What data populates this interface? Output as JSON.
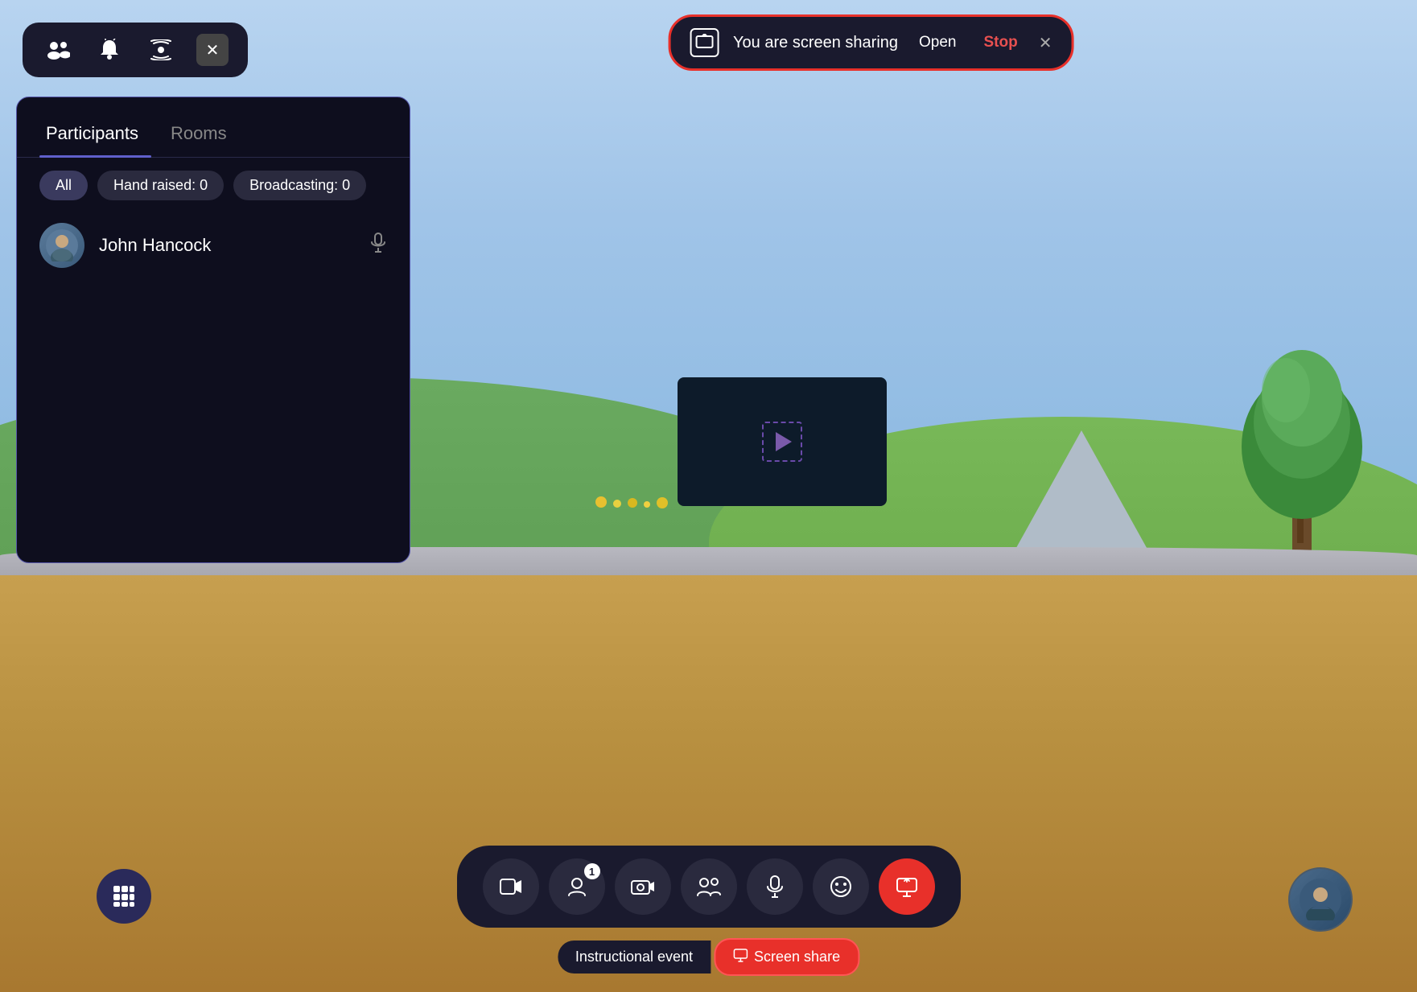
{
  "scene": {
    "background_color": "#87b5d4"
  },
  "top_toolbar": {
    "icons": [
      "people",
      "bell",
      "broadcast",
      "close"
    ],
    "close_label": "✕"
  },
  "screen_share_bar": {
    "title": "You are screen sharing",
    "open_label": "Open",
    "stop_label": "Stop",
    "close_label": "✕"
  },
  "participants_panel": {
    "tabs": [
      {
        "label": "Participants",
        "active": true
      },
      {
        "label": "Rooms",
        "active": false
      }
    ],
    "filters": [
      {
        "label": "All",
        "active": true
      },
      {
        "label": "Hand raised: 0",
        "active": false
      },
      {
        "label": "Broadcasting: 0",
        "active": false
      }
    ],
    "participants": [
      {
        "name": "John Hancock",
        "has_mic": true
      }
    ]
  },
  "bottom_toolbar": {
    "buttons": [
      {
        "icon": "🎬",
        "label": "film",
        "active": false
      },
      {
        "icon": "👤",
        "label": "person",
        "active": false,
        "badge": "1"
      },
      {
        "icon": "📷",
        "label": "camera",
        "active": false
      },
      {
        "icon": "👥",
        "label": "people",
        "active": false
      },
      {
        "icon": "🎤",
        "label": "mic",
        "active": false
      },
      {
        "icon": "😊",
        "label": "emoji",
        "active": false
      },
      {
        "icon": "📱",
        "label": "screen-share",
        "active": true
      }
    ]
  },
  "bottom_labels": {
    "instructional_label": "Instructional event",
    "screen_share_label": "Screen share",
    "screen_share_icon": "📱"
  },
  "grid_button": {
    "icon": "⋯"
  },
  "user_corner": {
    "initials": "👤"
  }
}
